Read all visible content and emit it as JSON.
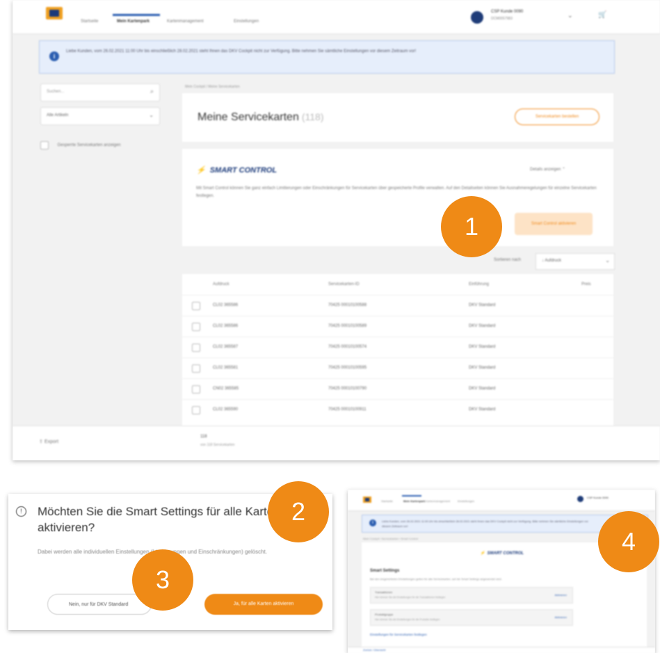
{
  "main": {
    "nav": {
      "tabs": [
        "Startseite",
        "Mein Kartenpark",
        "Kartenmanagement",
        "Einstellungen"
      ],
      "user_name": "CSP Kunde 0090",
      "user_sub": "DCM0057983",
      "chevron_icon": "chevron-down-icon",
      "cart_icon": "cart-icon"
    },
    "banner": {
      "icon": "info-icon",
      "text": "Liebe Kunden, vom 26.02.2021 11:00 Uhr bis einschließlich 28.02.2021 steht Ihnen das DKV Cockpit nicht zur Verfügung. Bitte nehmen Sie sämtliche Einstellungen vor diesem Zeitraum vor!"
    },
    "sidebar": {
      "search_placeholder": "Suchen...",
      "filter_value": "Alle Artikeln",
      "checkbox_label": "Gesperrte Servicekarten anzeigen"
    },
    "breadcrumb": "Mein Cockpit / Meine Servicekarten",
    "title": {
      "text": "Meine Servicekarten",
      "count": "(118)",
      "action_label": "Servicekarten bestellen"
    },
    "smart": {
      "title": "SMART CONTROL",
      "details_label": "Details anzeigen",
      "description": "Mit Smart Control können Sie ganz einfach Limitierungen oder Einschränkungen für Servicekarten über gespeicherte Profile verwalten. Auf den Detailseiten können Sie Ausnahmeregelungen für einzelne Servicekarten festlegen.",
      "button_label": "Smart Control aktivieren"
    },
    "sort": {
      "label": "Sortieren nach",
      "value": "↓ Aufdruck"
    },
    "table": {
      "headers": [
        "Aufdruck",
        "Servicekarten-ID",
        "Einführung",
        "Preis"
      ],
      "rows": [
        [
          "CL02 365586",
          "70425 00010100588",
          "DKV Standard"
        ],
        [
          "CL02 365586",
          "70425 00010100589",
          "DKV Standard"
        ],
        [
          "CL02 365587",
          "70425 00010100574",
          "DKV Standard"
        ],
        [
          "CL02 365581",
          "70425 00010100595",
          "DKV Standard"
        ],
        [
          "CN02 365585",
          "70425 00010100790",
          "DKV Standard"
        ],
        [
          "CL02 365590",
          "70425 00010100911",
          "DKV Standard"
        ]
      ]
    },
    "footer": {
      "export_label": "Export",
      "count": "118",
      "count_sub": "von 118 Servicekarten"
    }
  },
  "dialog": {
    "title": "Möchten Sie die Smart Settings für alle Karten aktivieren?",
    "body": "Dabei werden alle individuellen Einstellungen (Limitierungen und Einschränkungen) gelöscht.",
    "no_label": "Nein, nur für DKV Standard",
    "yes_label": "Ja, für alle Karten aktivieren"
  },
  "small": {
    "tabs": [
      "Startseite",
      "Mein Kartenpark",
      "Kartenmanagement",
      "Einstellungen"
    ],
    "user_name": "CSP Kunde 0090",
    "banner_text": "Liebe Kunden, vom 26.02.2021 11:00 Uhr bis einschließlich 28.02.2021 steht Ihnen das DKV Cockpit nicht zur Verfügung. Bitte nehmen Sie sämtliche Einstellungen vor diesem Zeitraum vor!",
    "breadcrumb": "Mein Cockpit / Servicekarten / Smart Control",
    "brand": "SMART CONTROL",
    "heading": "Smart Settings",
    "description": "Bei den eingerichteten Einstellungen gelten für alle Servicekarten, auf die Smart Settings angewendet sind.",
    "settings": [
      {
        "name": "Transaktionen",
        "desc": "Hier können Sie die Einstellungen für die Transaktionen festlegen",
        "action": "Aktivieren"
      },
      {
        "name": "Produktgruppe",
        "desc": "Hier können Sie die Einstellungen für die Produkte festlegen",
        "action": "Aktivieren"
      }
    ],
    "link": "Einstellungen für Servicekarten festlegen",
    "footer_link": "Zurück / Übersicht"
  },
  "markers": [
    "1",
    "2",
    "3",
    "4"
  ]
}
